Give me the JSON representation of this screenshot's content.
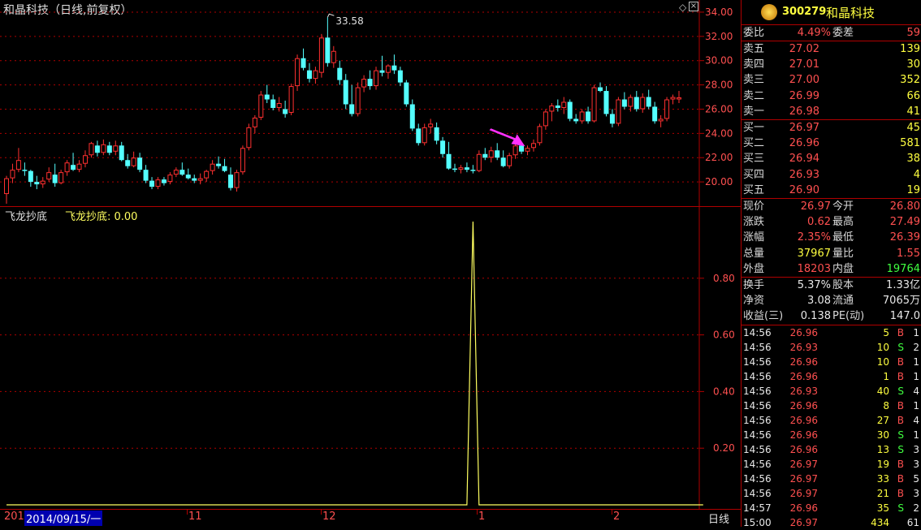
{
  "header": {
    "title": "和晶科技（日线,前复权）",
    "indicator_name": "飞龙抄底",
    "indicator_value": "飞龙抄底: 0.00",
    "period_label": "日线"
  },
  "price_chart": {
    "y_ticks": [
      "34.00",
      "32.00",
      "30.00",
      "28.00",
      "26.00",
      "24.00",
      "22.00",
      "20.00"
    ],
    "high_label": "33.58",
    "low_label": "18.20",
    "up_color": "#ff3030",
    "down_color": "#54ffff",
    "candles": [
      [
        19.0,
        20.5,
        18.2,
        20.3
      ],
      [
        20.3,
        21.5,
        19.9,
        21.0
      ],
      [
        21.0,
        22.8,
        20.8,
        21.8
      ],
      [
        21.0,
        21.6,
        20.5,
        20.9
      ],
      [
        20.9,
        21.0,
        19.6,
        20.0
      ],
      [
        20.0,
        20.5,
        19.4,
        19.8
      ],
      [
        19.8,
        20.4,
        19.5,
        20.1
      ],
      [
        20.2,
        21.2,
        20.0,
        20.8
      ],
      [
        20.6,
        21.5,
        19.6,
        19.9
      ],
      [
        19.9,
        21.0,
        19.8,
        20.8
      ],
      [
        20.8,
        21.8,
        20.5,
        21.6
      ],
      [
        21.4,
        22.4,
        20.9,
        21.0
      ],
      [
        21.0,
        21.8,
        20.8,
        21.5
      ],
      [
        21.5,
        22.6,
        21.2,
        22.2
      ],
      [
        22.2,
        23.3,
        22.0,
        23.2
      ],
      [
        23.0,
        23.4,
        22.1,
        22.4
      ],
      [
        22.4,
        23.5,
        22.2,
        23.1
      ],
      [
        23.0,
        23.3,
        22.2,
        22.4
      ],
      [
        22.5,
        23.4,
        22.2,
        23.0
      ],
      [
        23.0,
        23.3,
        21.7,
        21.8
      ],
      [
        21.8,
        22.3,
        21.1,
        21.3
      ],
      [
        21.3,
        22.5,
        21.2,
        22.0
      ],
      [
        22.0,
        22.4,
        20.8,
        21.0
      ],
      [
        21.0,
        21.4,
        19.9,
        20.1
      ],
      [
        20.1,
        20.4,
        19.4,
        19.6
      ],
      [
        19.6,
        20.4,
        19.4,
        20.2
      ],
      [
        20.2,
        20.4,
        19.7,
        19.9
      ],
      [
        20.0,
        20.8,
        19.8,
        20.6
      ],
      [
        20.6,
        21.2,
        20.4,
        21.0
      ],
      [
        21.0,
        21.6,
        20.5,
        20.6
      ],
      [
        20.6,
        21.1,
        20.2,
        20.3
      ],
      [
        20.3,
        20.6,
        19.9,
        20.1
      ],
      [
        20.1,
        20.7,
        19.8,
        20.3
      ],
      [
        20.3,
        21.0,
        20.0,
        20.9
      ],
      [
        20.9,
        21.8,
        20.6,
        21.5
      ],
      [
        21.5,
        22.1,
        21.1,
        21.3
      ],
      [
        21.3,
        21.9,
        20.8,
        20.9
      ],
      [
        20.6,
        21.2,
        19.3,
        19.5
      ],
      [
        19.5,
        21.0,
        19.2,
        20.8
      ],
      [
        20.8,
        23.0,
        20.6,
        22.8
      ],
      [
        22.8,
        24.8,
        22.6,
        24.5
      ],
      [
        24.5,
        25.5,
        24.0,
        25.3
      ],
      [
        25.3,
        27.5,
        25.1,
        27.2
      ],
      [
        27.2,
        28.0,
        26.5,
        26.8
      ],
      [
        26.8,
        27.2,
        25.9,
        26.1
      ],
      [
        26.1,
        27.0,
        25.8,
        26.5
      ],
      [
        26.0,
        26.7,
        25.3,
        25.6
      ],
      [
        25.7,
        28.1,
        25.5,
        27.9
      ],
      [
        27.9,
        30.5,
        27.5,
        30.2
      ],
      [
        30.2,
        31.0,
        29.2,
        29.4
      ],
      [
        29.2,
        29.8,
        28.2,
        28.5
      ],
      [
        28.5,
        29.5,
        28.1,
        29.2
      ],
      [
        29.0,
        32.2,
        28.6,
        31.9
      ],
      [
        31.9,
        33.58,
        29.5,
        29.8
      ],
      [
        29.8,
        31.2,
        29.4,
        30.8
      ],
      [
        29.4,
        30.0,
        28.0,
        28.4
      ],
      [
        28.4,
        28.9,
        26.0,
        26.4
      ],
      [
        26.4,
        28.0,
        25.4,
        25.6
      ],
      [
        25.6,
        28.2,
        25.4,
        27.8
      ],
      [
        27.8,
        28.8,
        27.4,
        28.5
      ],
      [
        28.5,
        29.2,
        27.6,
        27.9
      ],
      [
        27.9,
        29.5,
        27.6,
        29.2
      ],
      [
        29.2,
        30.4,
        28.7,
        29.0
      ],
      [
        29.0,
        29.7,
        28.5,
        29.6
      ],
      [
        29.6,
        30.5,
        28.9,
        29.2
      ],
      [
        29.2,
        29.5,
        27.9,
        28.2
      ],
      [
        28.2,
        28.4,
        26.2,
        26.4
      ],
      [
        26.4,
        26.8,
        24.2,
        24.4
      ],
      [
        24.4,
        24.8,
        23.0,
        23.2
      ],
      [
        23.2,
        24.8,
        23.0,
        24.5
      ],
      [
        24.5,
        25.2,
        24.0,
        24.8
      ],
      [
        24.5,
        24.9,
        23.1,
        23.4
      ],
      [
        23.4,
        23.7,
        22.0,
        22.3
      ],
      [
        22.3,
        23.3,
        21.0,
        21.1
      ],
      [
        21.1,
        21.5,
        20.8,
        21.0
      ],
      [
        21.0,
        21.4,
        20.7,
        21.2
      ],
      [
        21.2,
        21.6,
        20.8,
        21.0
      ],
      [
        21.0,
        21.4,
        20.7,
        20.9
      ],
      [
        20.9,
        22.6,
        20.8,
        22.3
      ],
      [
        22.3,
        22.8,
        21.8,
        22.0
      ],
      [
        22.0,
        22.9,
        21.6,
        22.6
      ],
      [
        22.6,
        23.2,
        21.8,
        22.0
      ],
      [
        22.0,
        22.6,
        21.2,
        21.3
      ],
      [
        21.3,
        22.4,
        21.1,
        22.2
      ],
      [
        22.2,
        23.3,
        21.9,
        23.0
      ],
      [
        23.0,
        23.2,
        22.3,
        22.5
      ],
      [
        22.5,
        23.0,
        22.2,
        22.8
      ],
      [
        22.8,
        23.5,
        22.5,
        23.2
      ],
      [
        23.2,
        24.8,
        23.0,
        24.6
      ],
      [
        24.6,
        26.0,
        24.3,
        25.8
      ],
      [
        25.8,
        26.5,
        25.0,
        26.3
      ],
      [
        26.3,
        26.8,
        25.8,
        26.1
      ],
      [
        26.1,
        27.0,
        25.6,
        26.6
      ],
      [
        26.6,
        26.8,
        25.0,
        25.2
      ],
      [
        25.2,
        25.6,
        24.8,
        25.0
      ],
      [
        25.0,
        26.0,
        24.8,
        25.8
      ],
      [
        25.8,
        26.2,
        24.8,
        25.0
      ],
      [
        25.0,
        28.0,
        24.9,
        27.8
      ],
      [
        27.8,
        28.2,
        27.4,
        27.5
      ],
      [
        27.5,
        27.9,
        25.4,
        25.6
      ],
      [
        25.6,
        26.0,
        24.5,
        24.8
      ],
      [
        24.8,
        27.0,
        24.6,
        26.8
      ],
      [
        26.8,
        27.4,
        26.0,
        26.2
      ],
      [
        26.2,
        27.2,
        25.8,
        27.0
      ],
      [
        27.0,
        27.5,
        25.8,
        26.0
      ],
      [
        26.0,
        27.3,
        25.7,
        27.0
      ],
      [
        27.0,
        27.6,
        26.0,
        26.2
      ],
      [
        26.2,
        26.6,
        24.8,
        25.0
      ],
      [
        25.0,
        25.5,
        24.5,
        25.2
      ],
      [
        25.2,
        27.0,
        25.0,
        26.8
      ],
      [
        26.8,
        27.2,
        26.4,
        27.0
      ],
      [
        26.8,
        27.5,
        26.5,
        26.97
      ]
    ],
    "arrow_color": "#ff30ff",
    "arrow_candle": 86
  },
  "indicator_chart": {
    "y_ticks": [
      "0.80",
      "0.60",
      "0.40",
      "0.20"
    ],
    "line_color": "#ffff60",
    "values_count": 116,
    "spike_index": 77,
    "spike_value": 1.0
  },
  "x_axis": {
    "date_labels": [
      "201",
      "11",
      "12",
      "1",
      "2"
    ],
    "cursor_date": "2014/09/15/一"
  },
  "quote": {
    "code": "300279",
    "name": "和晶科技",
    "weibi_label": "委比",
    "weibi": "4.49%",
    "weicha_label": "委差",
    "weicha": "59",
    "asks": [
      {
        "label": "卖五",
        "price": "27.02",
        "vol": "139"
      },
      {
        "label": "卖四",
        "price": "27.01",
        "vol": "30"
      },
      {
        "label": "卖三",
        "price": "27.00",
        "vol": "352"
      },
      {
        "label": "卖二",
        "price": "26.99",
        "vol": "66"
      },
      {
        "label": "卖一",
        "price": "26.98",
        "vol": "41"
      }
    ],
    "bids": [
      {
        "label": "买一",
        "price": "26.97",
        "vol": "45"
      },
      {
        "label": "买二",
        "price": "26.96",
        "vol": "581"
      },
      {
        "label": "买三",
        "price": "26.94",
        "vol": "38"
      },
      {
        "label": "买四",
        "price": "26.93",
        "vol": "4"
      },
      {
        "label": "买五",
        "price": "26.90",
        "vol": "19"
      }
    ],
    "stats": [
      {
        "l1": "现价",
        "v1": "26.97",
        "c1": "red",
        "l2": "今开",
        "v2": "26.80",
        "c2": "red"
      },
      {
        "l1": "涨跌",
        "v1": "0.62",
        "c1": "red",
        "l2": "最高",
        "v2": "27.49",
        "c2": "red"
      },
      {
        "l1": "涨幅",
        "v1": "2.35%",
        "c1": "red",
        "l2": "最低",
        "v2": "26.39",
        "c2": "red"
      },
      {
        "l1": "总量",
        "v1": "37967",
        "c1": "yel",
        "l2": "量比",
        "v2": "1.55",
        "c2": "red"
      },
      {
        "l1": "外盘",
        "v1": "18203",
        "c1": "red",
        "l2": "内盘",
        "v2": "19764",
        "c2": "grn"
      }
    ],
    "fundamentals": [
      {
        "l1": "换手",
        "v1": "5.37%",
        "l2": "股本",
        "v2": "1.33亿"
      },
      {
        "l1": "净资",
        "v1": "3.08",
        "l2": "流通",
        "v2": "7065万"
      },
      {
        "l1": "收益(三)",
        "v1": "0.138",
        "l2": "PE(动)",
        "v2": "147.0"
      }
    ],
    "ticks": [
      {
        "t": "14:56",
        "p": "26.96",
        "v": "5",
        "s": "B",
        "n": "1"
      },
      {
        "t": "14:56",
        "p": "26.93",
        "v": "10",
        "s": "S",
        "n": "2"
      },
      {
        "t": "14:56",
        "p": "26.96",
        "v": "10",
        "s": "B",
        "n": "1"
      },
      {
        "t": "14:56",
        "p": "26.96",
        "v": "1",
        "s": "B",
        "n": "1"
      },
      {
        "t": "14:56",
        "p": "26.93",
        "v": "40",
        "s": "S",
        "n": "4"
      },
      {
        "t": "14:56",
        "p": "26.96",
        "v": "8",
        "s": "B",
        "n": "1"
      },
      {
        "t": "14:56",
        "p": "26.96",
        "v": "27",
        "s": "B",
        "n": "4"
      },
      {
        "t": "14:56",
        "p": "26.96",
        "v": "30",
        "s": "S",
        "n": "1"
      },
      {
        "t": "14:56",
        "p": "26.96",
        "v": "13",
        "s": "S",
        "n": "3"
      },
      {
        "t": "14:56",
        "p": "26.97",
        "v": "19",
        "s": "B",
        "n": "3"
      },
      {
        "t": "14:56",
        "p": "26.97",
        "v": "33",
        "s": "B",
        "n": "5"
      },
      {
        "t": "14:56",
        "p": "26.97",
        "v": "21",
        "s": "B",
        "n": "3"
      },
      {
        "t": "14:57",
        "p": "26.96",
        "v": "35",
        "s": "S",
        "n": "2"
      },
      {
        "t": "15:00",
        "p": "26.97",
        "v": "434",
        "s": "",
        "n": "61"
      }
    ]
  }
}
